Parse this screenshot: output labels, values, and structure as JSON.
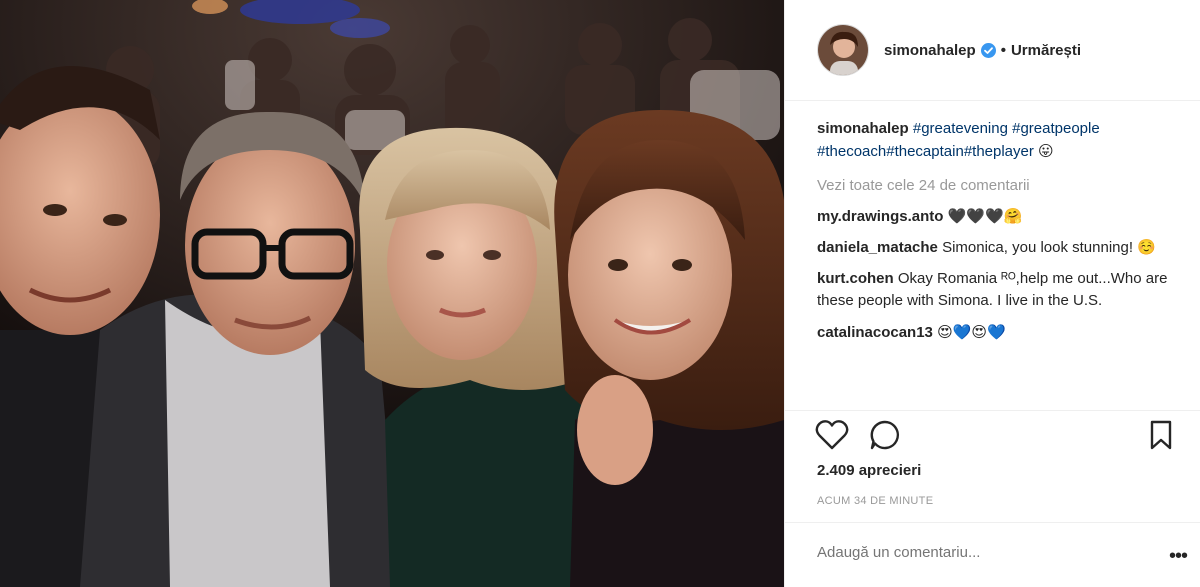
{
  "post": {
    "username": "simonahalep",
    "follow_status": "Urmărești",
    "separator": "•",
    "caption": {
      "username": "simonahalep",
      "tags": [
        "#greatevening",
        "#greatpeople",
        "#thecoach",
        "#thecaptain",
        "#theplayer"
      ],
      "emoji": "😛"
    },
    "view_all": "Vezi toate cele 24 de comentarii",
    "comments": [
      {
        "user": "my.drawings.anto",
        "text": "🖤🖤🖤🤗"
      },
      {
        "user": "daniela_matache",
        "text": "Simonica, you look stunning! ☺️"
      },
      {
        "user": "kurt.cohen",
        "text": "Okay Romania ᴿᴼ,help me out...Who are these people with Simona. I live in the U.S."
      },
      {
        "user": "catalinacocan13",
        "text": "😍💙😍💙"
      }
    ],
    "likes": "2.409 aprecieri",
    "time": "ACUM 34 DE MINUTE",
    "add_comment_placeholder": "Adaugă un comentariu...",
    "more_label": "•••",
    "icons": {
      "like": "heart-icon",
      "comment": "comment-icon",
      "save": "bookmark-icon",
      "verified": "verified-badge-icon"
    },
    "colors": {
      "link": "#003569",
      "verified": "#3897f0",
      "muted": "#999999",
      "text": "#262626"
    }
  }
}
